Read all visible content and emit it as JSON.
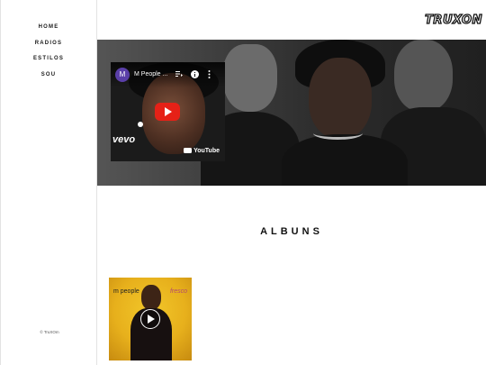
{
  "nav": {
    "items": [
      {
        "label": "HOME"
      },
      {
        "label": "RADIOS"
      },
      {
        "label": "ESTILOS"
      },
      {
        "label": "SOU"
      }
    ]
  },
  "footer": {
    "copyright": "© TruXOm"
  },
  "header": {
    "logo_text": "TRUXON"
  },
  "video": {
    "channel_initial": "M",
    "title": "M People ...",
    "brand_watermark": "vevo",
    "youtube_label": "YouTube",
    "icons": [
      "playlist-icon",
      "info-icon",
      "more-vertical-icon",
      "play-icon",
      "youtube-logo-icon"
    ]
  },
  "albums_section": {
    "title": "ALBUNS",
    "albums": [
      {
        "artist_text": "m people",
        "title_text": "fresco",
        "accent_color": "#e9b51f"
      }
    ]
  },
  "colors": {
    "youtube_red": "#e62117",
    "avatar_purple": "#5a3fa8"
  }
}
